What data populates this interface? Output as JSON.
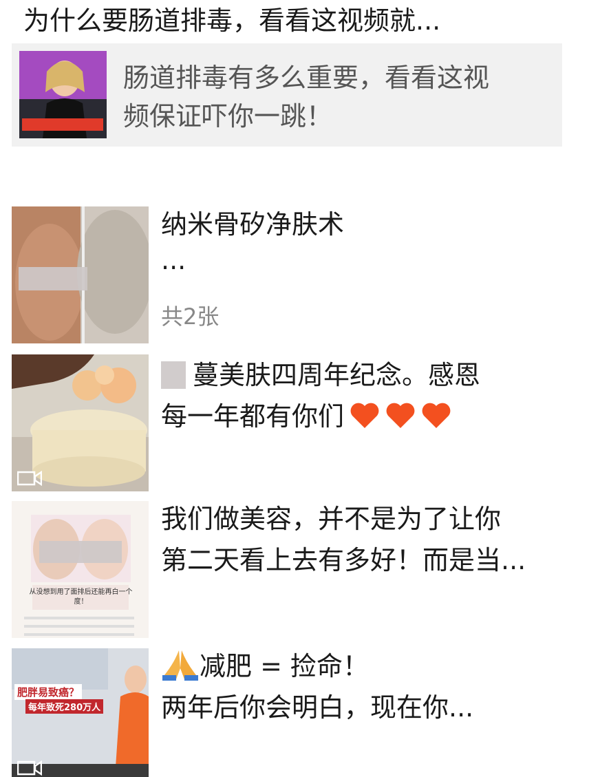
{
  "header": {
    "title": "为什么要肠道排毒，看看这视频就..."
  },
  "link_card": {
    "text_line1": "肠道排毒有多么重要，看看这视",
    "text_line2": "频保证吓你一跳！"
  },
  "posts": [
    {
      "line1": "纳米骨矽净肤术",
      "line2": "...",
      "meta": "共2张"
    },
    {
      "line1": "蔓美肤四周年纪念。感恩",
      "line2": "每一年都有你们"
    },
    {
      "line1": "我们做美容，并不是为了让你",
      "line2": "第二天看上去有多好！而是当...",
      "thumb_caption": "从没想到用了面排后还能再白一个度！"
    },
    {
      "line1": "减肥 = 捡命！",
      "line2": "两年后你会明白，现在你...",
      "thumb_caption_top": "肥胖易致癌？",
      "thumb_caption_bottom": "每年致死280万人"
    }
  ],
  "colors": {
    "heart": "#f3501f",
    "card_bg": "#f1f1f1",
    "muted": "#888888"
  }
}
